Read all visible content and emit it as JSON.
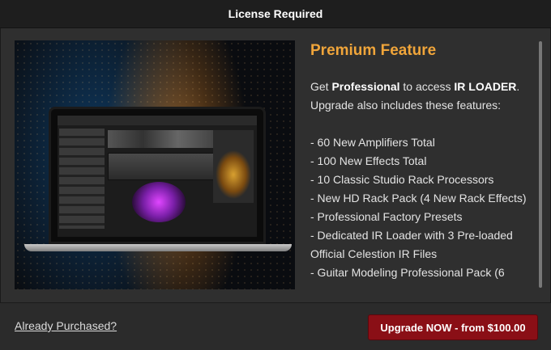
{
  "window": {
    "title": "License Required"
  },
  "promo": {
    "heading": "Premium Feature",
    "intro_prefix": "Get ",
    "plan_name": "Professional",
    "intro_mid": " to access ",
    "feature_name": "IR LOADER",
    "intro_suffix": ".",
    "includes_line": "Upgrade also includes these features:",
    "features": [
      "- 60 New Amplifiers Total",
      "- 100 New Effects Total",
      "- 10 Classic Studio Rack Processors",
      "- New HD Rack Pack (4 New Rack Effects)",
      "- Professional Factory Presets",
      "- Dedicated IR Loader with 3 Pre-loaded Official Celestion IR Files",
      "- Guitar Modeling Professional Pack (6"
    ]
  },
  "footer": {
    "already_purchased_label": "Already Purchased?",
    "upgrade_label": "Upgrade NOW - from $100.00"
  },
  "colors": {
    "accent": "#f0a53a",
    "upgrade_button": "#8a0f16",
    "background": "#2f2f2f"
  }
}
